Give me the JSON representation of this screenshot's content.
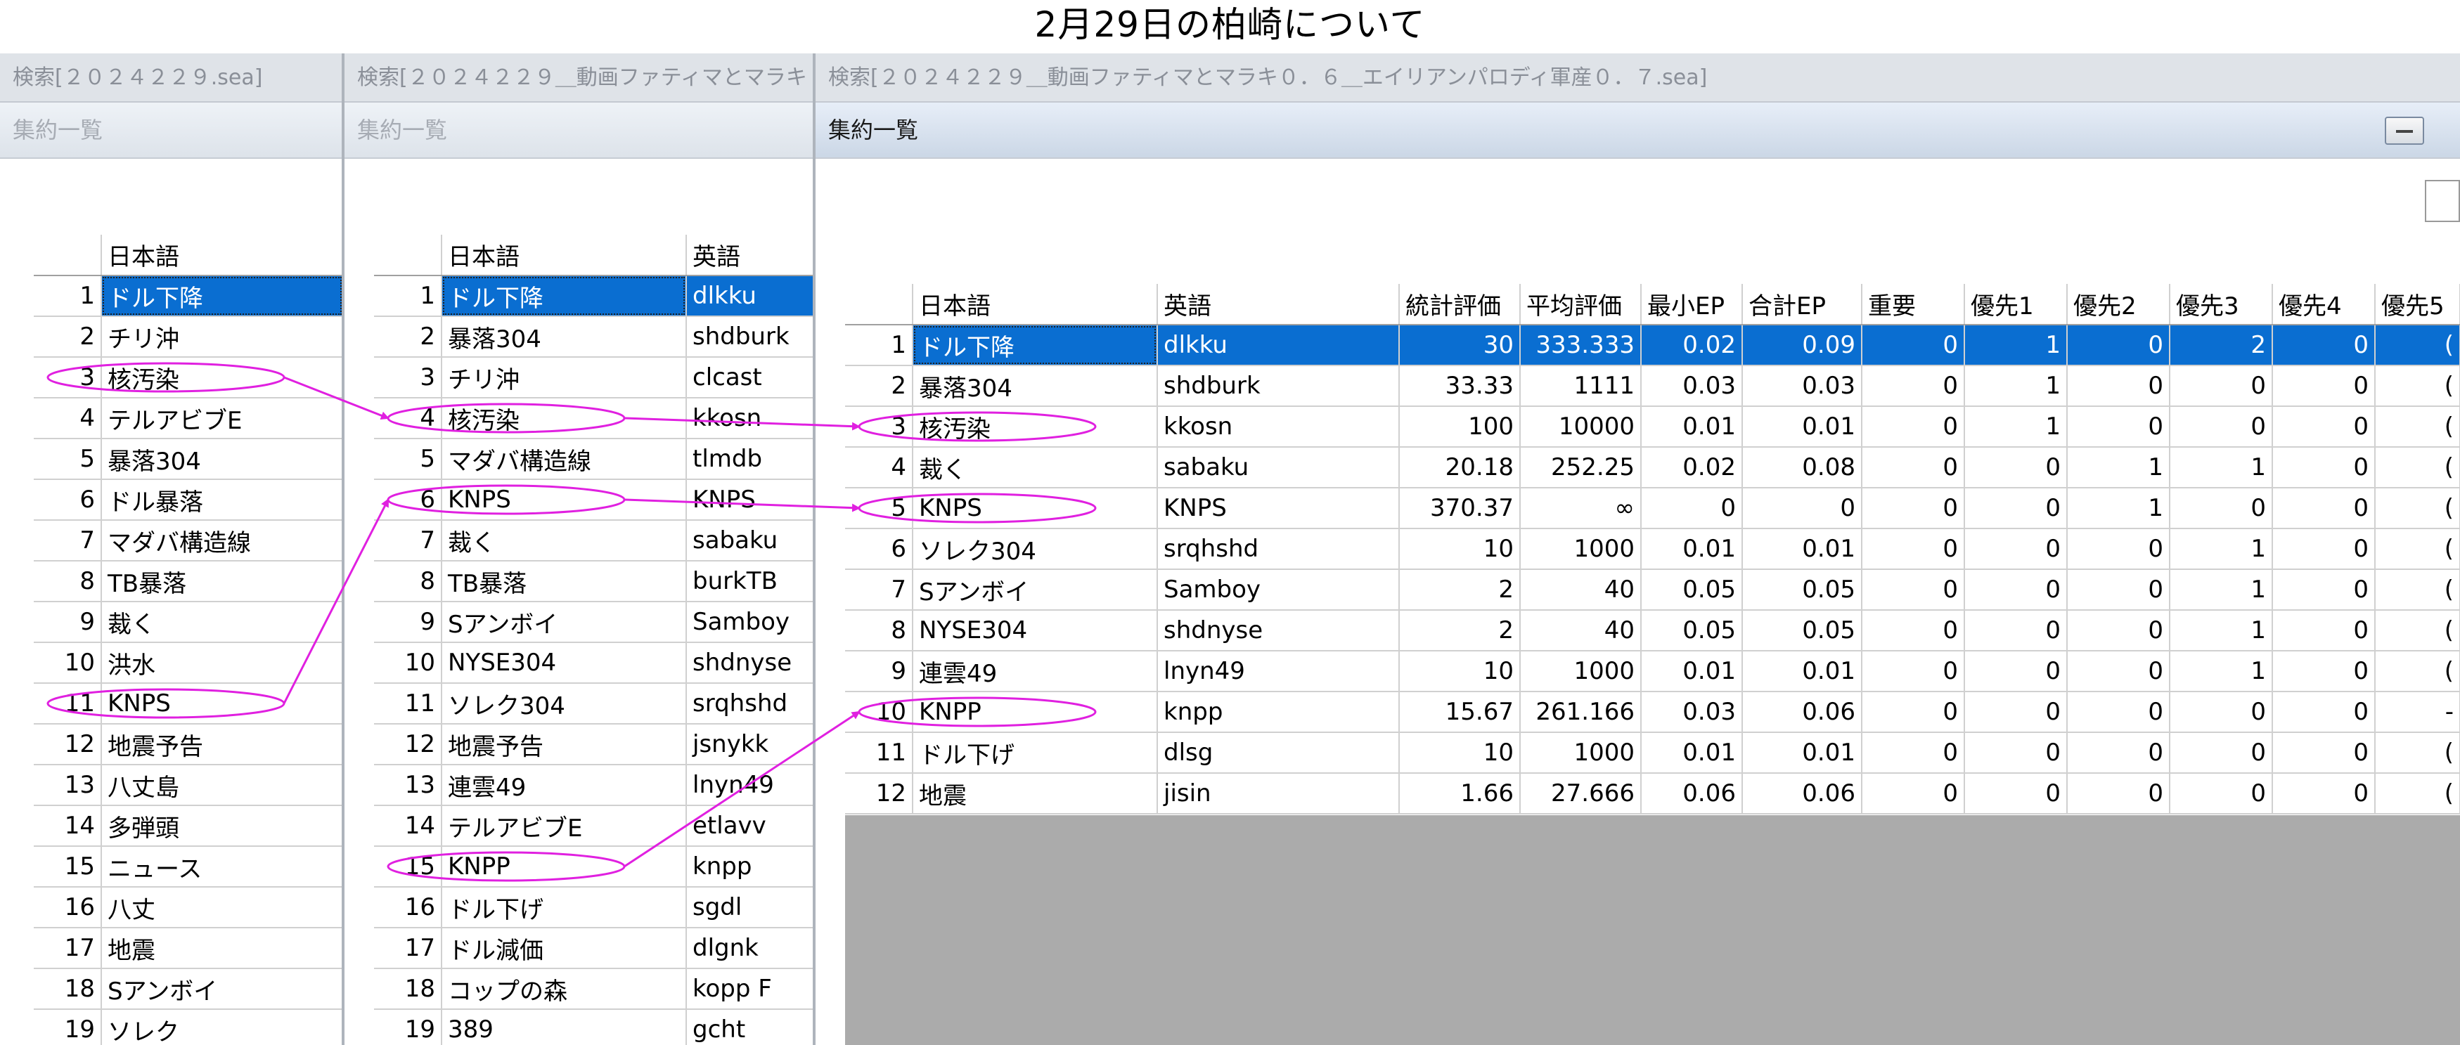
{
  "page_title": "2月29日の柏崎について",
  "windows": [
    {
      "title": "検索[２０２４２２９.sea]",
      "subtitle": "集約一覧",
      "columns": [
        "",
        "日本語"
      ],
      "rows": [
        [
          "1",
          "ドル下降"
        ],
        [
          "2",
          "チリ沖"
        ],
        [
          "3",
          "核汚染"
        ],
        [
          "4",
          "テルアビブE"
        ],
        [
          "5",
          "暴落304"
        ],
        [
          "6",
          "ドル暴落"
        ],
        [
          "7",
          "マダバ構造線"
        ],
        [
          "8",
          "TB暴落"
        ],
        [
          "9",
          "裁く"
        ],
        [
          "10",
          "洪水"
        ],
        [
          "11",
          "KNPS"
        ],
        [
          "12",
          "地震予告"
        ],
        [
          "13",
          "八丈島"
        ],
        [
          "14",
          "多弾頭"
        ],
        [
          "15",
          "ニュース"
        ],
        [
          "16",
          "八丈"
        ],
        [
          "17",
          "地震"
        ],
        [
          "18",
          "Sアンボイ"
        ],
        [
          "19",
          "ソレク"
        ]
      ]
    },
    {
      "title": "検索[２０２４２２９＿動画ファティマとマラキ",
      "subtitle": "集約一覧",
      "columns": [
        "",
        "日本語",
        "英語"
      ],
      "rows": [
        [
          "1",
          "ドル下降",
          "dlkku"
        ],
        [
          "2",
          "暴落304",
          "shdburk"
        ],
        [
          "3",
          "チリ沖",
          "clcast"
        ],
        [
          "4",
          "核汚染",
          "kkosn"
        ],
        [
          "5",
          "マダバ構造線",
          "tlmdb"
        ],
        [
          "6",
          "KNPS",
          "KNPS"
        ],
        [
          "7",
          "裁く",
          "sabaku"
        ],
        [
          "8",
          "TB暴落",
          "burkTB"
        ],
        [
          "9",
          "Sアンボイ",
          "Samboy"
        ],
        [
          "10",
          "NYSE304",
          "shdnyse"
        ],
        [
          "11",
          "ソレク304",
          "srqhshd"
        ],
        [
          "12",
          "地震予告",
          "jsnykk"
        ],
        [
          "13",
          "連雲49",
          "lnyn49"
        ],
        [
          "14",
          "テルアビブE",
          "etlavv"
        ],
        [
          "15",
          "KNPP",
          "knpp"
        ],
        [
          "16",
          "ドル下げ",
          "sgdl"
        ],
        [
          "17",
          "ドル減価",
          "dlgnk"
        ],
        [
          "18",
          "コップの森",
          "kopp F"
        ],
        [
          "19",
          "389",
          "gcht"
        ]
      ]
    },
    {
      "title": "検索[２０２４２２９＿動画ファティマとマラキ０．６＿エイリアンパロディ軍産０．７.sea]",
      "subtitle": "集約一覧",
      "columns": [
        "",
        "日本語",
        "英語",
        "統計評価",
        "平均評価",
        "最小EP",
        "合計EP",
        "重要",
        "優先1",
        "優先2",
        "優先3",
        "優先4",
        "優先5"
      ],
      "rows": [
        [
          "1",
          "ドル下降",
          "dlkku",
          "30",
          "333.333",
          "0.02",
          "0.09",
          "0",
          "1",
          "0",
          "2",
          "0",
          "("
        ],
        [
          "2",
          "暴落304",
          "shdburk",
          "33.33",
          "1111",
          "0.03",
          "0.03",
          "0",
          "1",
          "0",
          "0",
          "0",
          "("
        ],
        [
          "3",
          "核汚染",
          "kkosn",
          "100",
          "10000",
          "0.01",
          "0.01",
          "0",
          "1",
          "0",
          "0",
          "0",
          "("
        ],
        [
          "4",
          "裁く",
          "sabaku",
          "20.18",
          "252.25",
          "0.02",
          "0.08",
          "0",
          "0",
          "1",
          "1",
          "0",
          "("
        ],
        [
          "5",
          "KNPS",
          "KNPS",
          "370.37",
          "∞",
          "0",
          "0",
          "0",
          "0",
          "1",
          "0",
          "0",
          "("
        ],
        [
          "6",
          "ソレク304",
          "srqhshd",
          "10",
          "1000",
          "0.01",
          "0.01",
          "0",
          "0",
          "0",
          "1",
          "0",
          "("
        ],
        [
          "7",
          "Sアンボイ",
          "Samboy",
          "2",
          "40",
          "0.05",
          "0.05",
          "0",
          "0",
          "0",
          "1",
          "0",
          "("
        ],
        [
          "8",
          "NYSE304",
          "shdnyse",
          "2",
          "40",
          "0.05",
          "0.05",
          "0",
          "0",
          "0",
          "1",
          "0",
          "("
        ],
        [
          "9",
          "連雲49",
          "lnyn49",
          "10",
          "1000",
          "0.01",
          "0.01",
          "0",
          "0",
          "0",
          "1",
          "0",
          "("
        ],
        [
          "10",
          "KNPP",
          "knpp",
          "15.67",
          "261.166",
          "0.03",
          "0.06",
          "0",
          "0",
          "0",
          "0",
          "0",
          "-"
        ],
        [
          "11",
          "ドル下げ",
          "dlsg",
          "10",
          "1000",
          "0.01",
          "0.01",
          "0",
          "0",
          "0",
          "0",
          "0",
          "("
        ],
        [
          "12",
          "地震",
          "jisin",
          "1.66",
          "27.666",
          "0.06",
          "0.06",
          "0",
          "0",
          "0",
          "0",
          "0",
          "("
        ]
      ]
    }
  ],
  "annotation_color": "#e020e0",
  "selection_color": "#0a6ed1"
}
